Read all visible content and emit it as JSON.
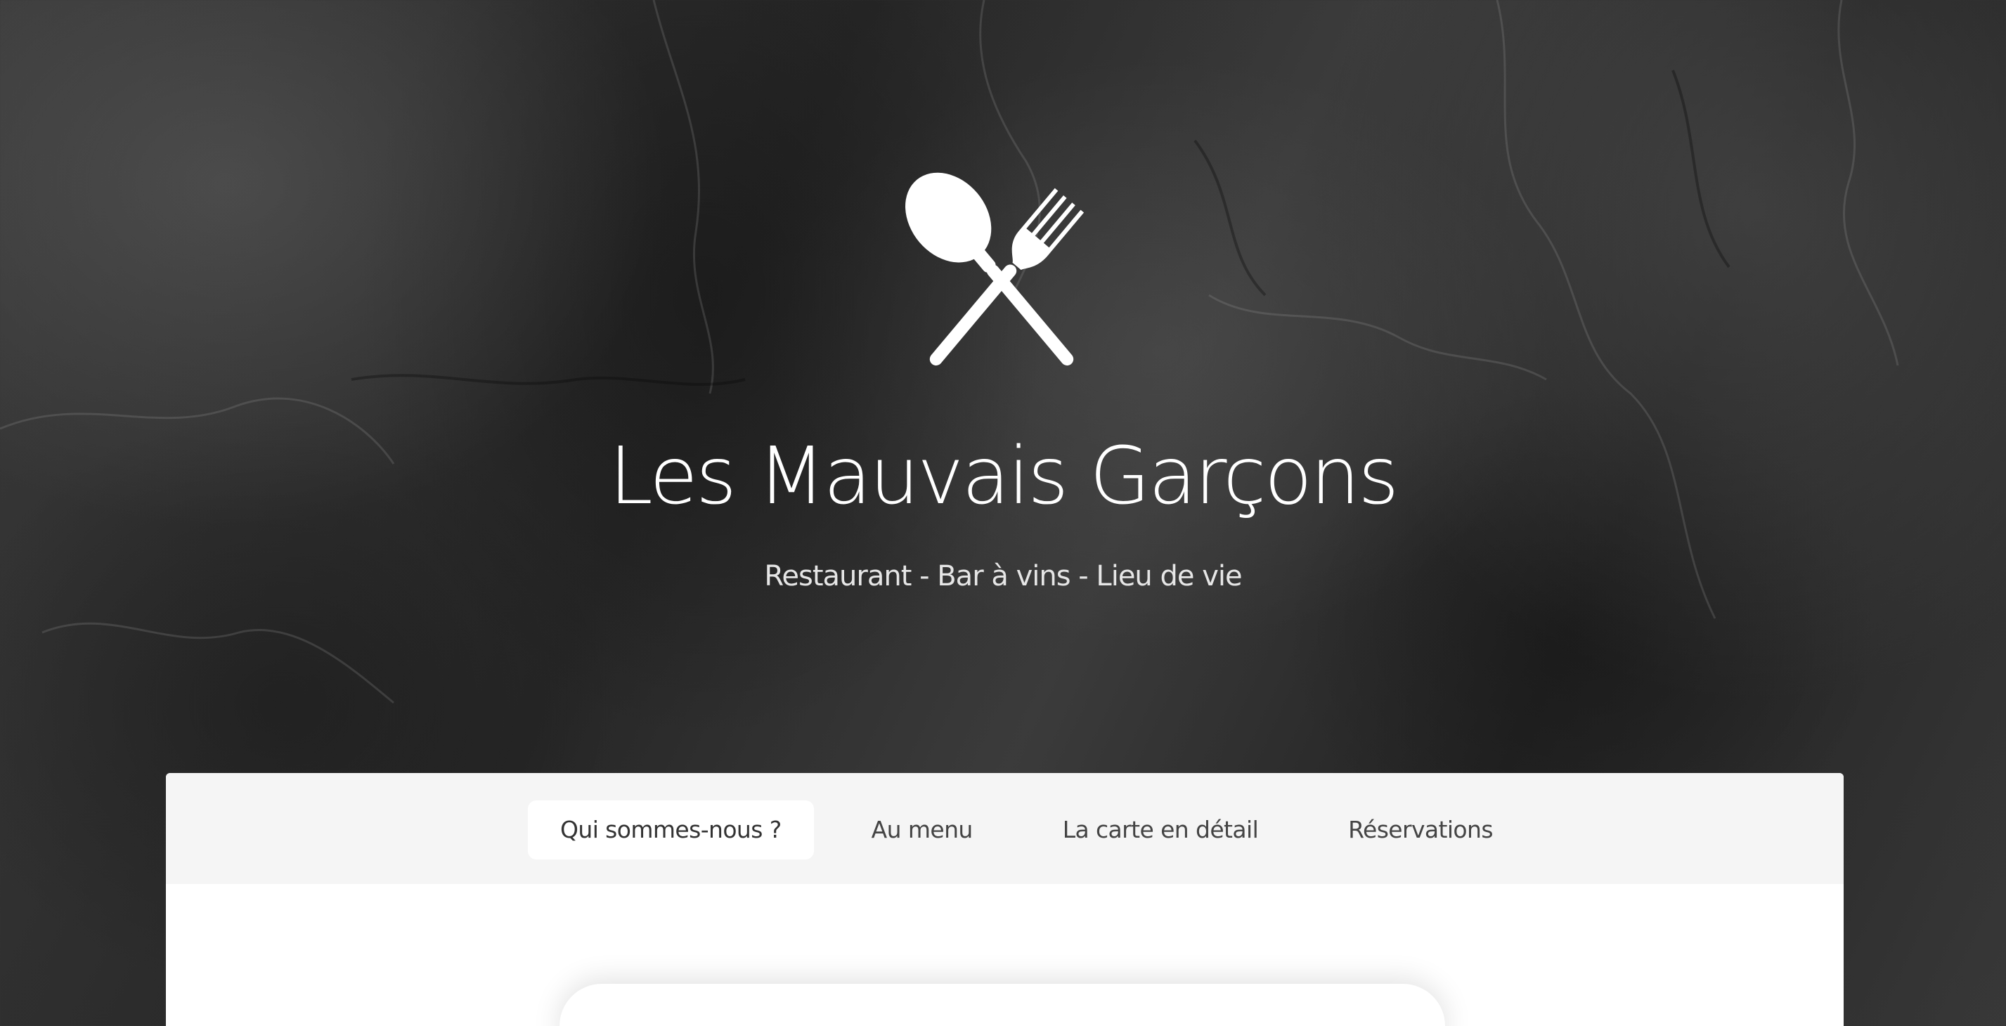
{
  "hero": {
    "logo_icon": "crossed-spoon-fork-icon",
    "title": "Les Mauvais Garçons",
    "subtitle": "Restaurant - Bar à vins - Lieu de vie"
  },
  "nav": {
    "items": [
      {
        "label": "Qui sommes-nous ?",
        "active": true
      },
      {
        "label": "Au menu",
        "active": false
      },
      {
        "label": "La carte en détail",
        "active": false
      },
      {
        "label": "Réservations",
        "active": false
      }
    ]
  },
  "colors": {
    "background": "#2e2e2e",
    "title": "#ffffff",
    "nav_bar": "#f5f5f5",
    "nav_text": "#444444",
    "panel": "#ffffff"
  }
}
